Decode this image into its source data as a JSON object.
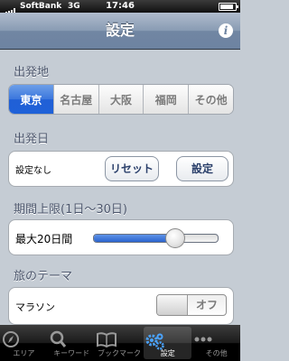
{
  "status_bar": {
    "carrier": "SoftBank",
    "network": "3G",
    "time": "17:46"
  },
  "nav": {
    "title": "設定",
    "info_icon": "info-icon"
  },
  "departure": {
    "header": "出発地",
    "options": [
      "東京",
      "名古屋",
      "大阪",
      "福岡",
      "その他"
    ],
    "selected": "東京"
  },
  "departure_date": {
    "header": "出発日",
    "value_label": "設定なし",
    "reset_label": "リセット",
    "set_label": "設定"
  },
  "period": {
    "header": "期間上限(1日〜30日)",
    "value_label": "最大20日間",
    "value": 20,
    "min": 1,
    "max": 30
  },
  "theme": {
    "header": "旅のテーマ",
    "item_label": "マラソン",
    "toggle_label": "オフ",
    "on": false
  },
  "tab_bar": {
    "tabs": [
      {
        "label": "エリア",
        "icon": "compass-icon"
      },
      {
        "label": "キーワード",
        "icon": "magnifier-icon"
      },
      {
        "label": "ブックマーク",
        "icon": "book-icon"
      },
      {
        "label": "設定",
        "icon": "gears-icon"
      },
      {
        "label": "その他",
        "icon": "more-icon"
      }
    ],
    "selected": "設定"
  },
  "colors": {
    "selected_blue": "#1f61d8",
    "background": "#c5ccd4",
    "nav_bar": "#6d83a1"
  }
}
